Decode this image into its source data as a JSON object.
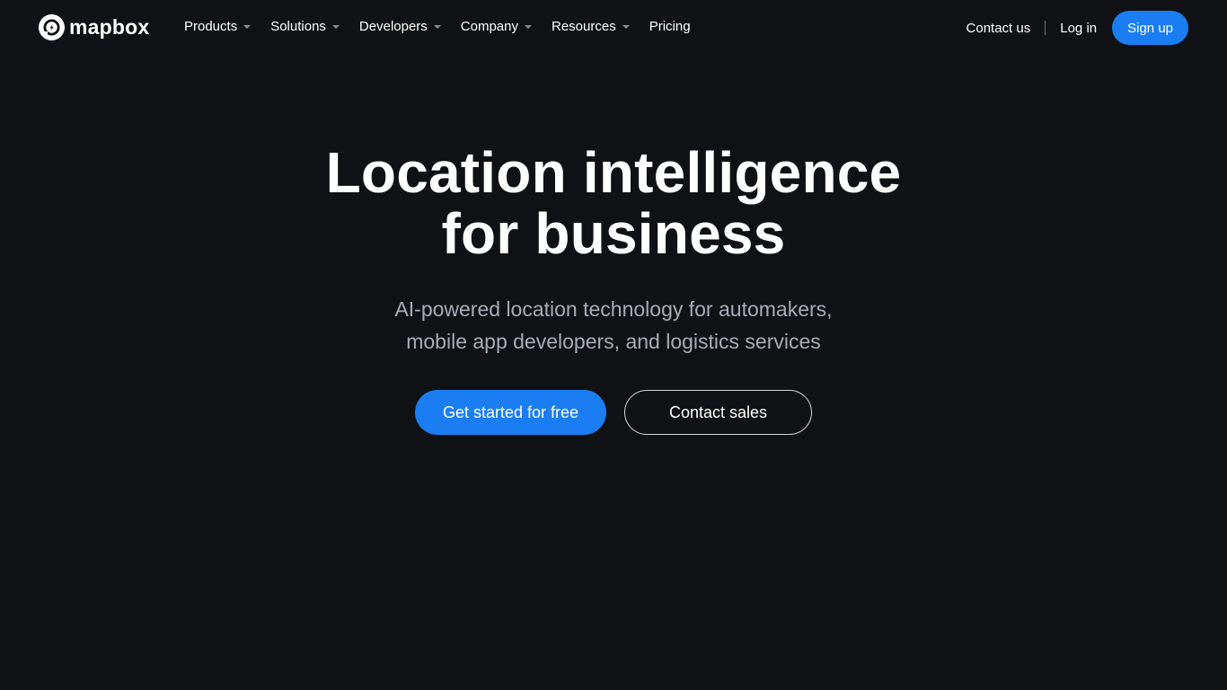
{
  "colors": {
    "background": "#101114",
    "accent": "#1a7ef2",
    "text": "#ffffff",
    "muted_text": "#a8acb6"
  },
  "header": {
    "logo": {
      "text": "mapbox",
      "icon": "mapbox-logo-icon"
    },
    "nav": [
      {
        "label": "Products",
        "has_dropdown": true
      },
      {
        "label": "Solutions",
        "has_dropdown": true
      },
      {
        "label": "Developers",
        "has_dropdown": true
      },
      {
        "label": "Company",
        "has_dropdown": true
      },
      {
        "label": "Resources",
        "has_dropdown": true
      },
      {
        "label": "Pricing",
        "has_dropdown": false
      }
    ],
    "contact_label": "Contact us",
    "login_label": "Log in",
    "signup_label": "Sign up"
  },
  "hero": {
    "title_line1": "Location intelligence",
    "title_line2": "for business",
    "subtitle_line1": "AI-powered location technology for automakers,",
    "subtitle_line2": "mobile app developers, and logistics services",
    "primary_cta": "Get started for free",
    "secondary_cta": "Contact sales"
  }
}
